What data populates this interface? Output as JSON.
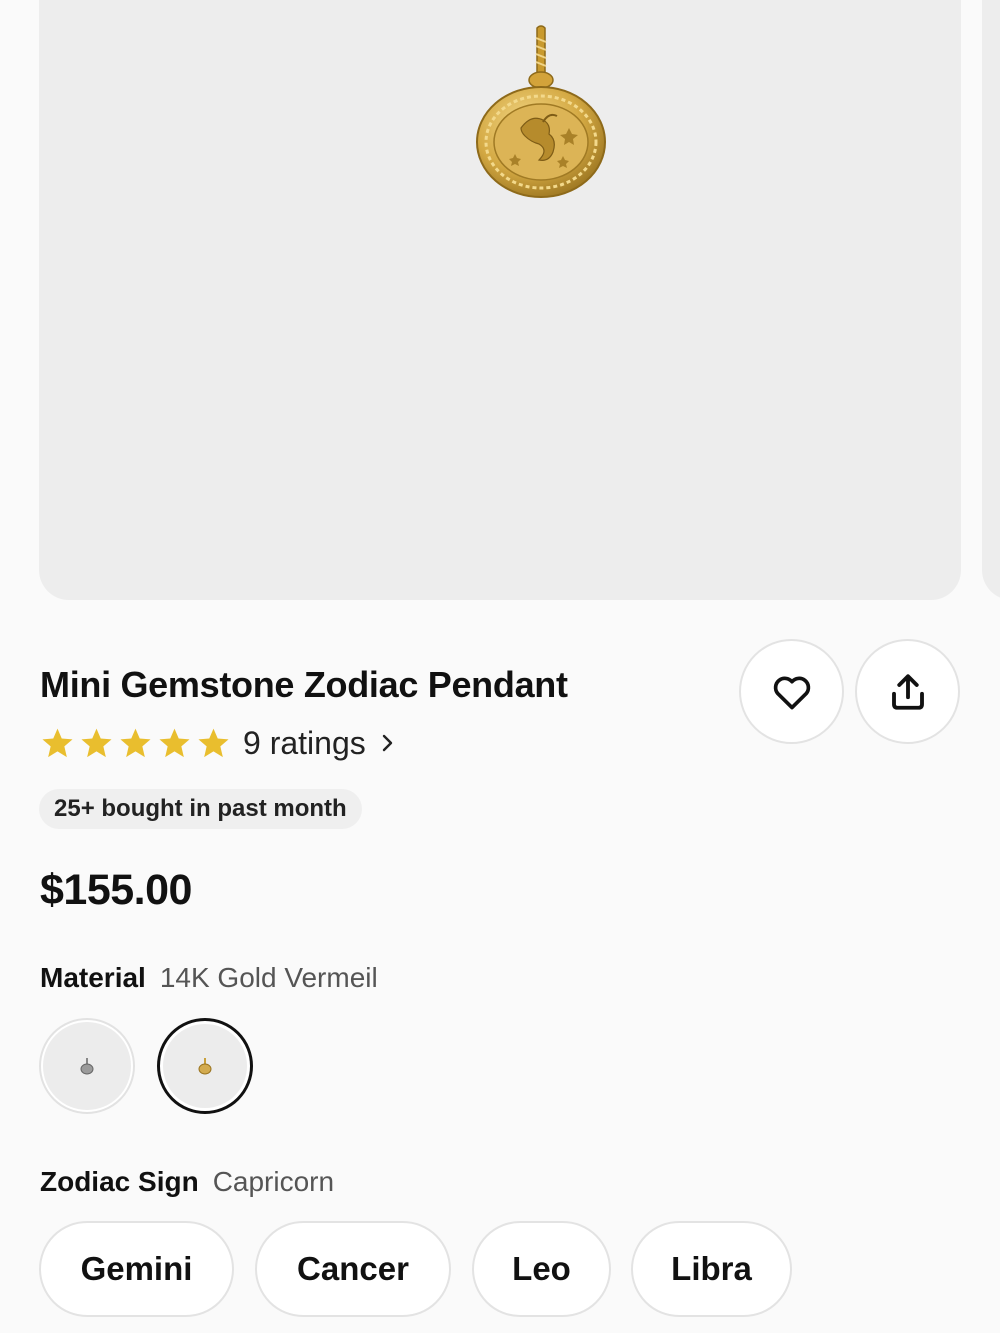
{
  "product": {
    "title": "Mini Gemstone Zodiac Pendant",
    "rating_stars": 5,
    "rating_text": "9 ratings",
    "badge": "25+ bought in past month",
    "price": "$155.00"
  },
  "material": {
    "label": "Material",
    "selected": "14K Gold Vermeil",
    "swatches": [
      {
        "name": "silver",
        "selected": false
      },
      {
        "name": "gold",
        "selected": true
      }
    ]
  },
  "zodiac": {
    "label": "Zodiac Sign",
    "selected": "Capricorn",
    "options": [
      "Gemini",
      "Cancer",
      "Leo",
      "Libra"
    ]
  },
  "icons": {
    "favorite": "heart-icon",
    "share": "share-icon",
    "rating": "star-icon",
    "more": "chevron-right-icon"
  },
  "colors": {
    "star": "#E9BE2E",
    "background": "#FAFAFA",
    "image_bg": "#EDEDED",
    "gold": "#C9A13C"
  }
}
